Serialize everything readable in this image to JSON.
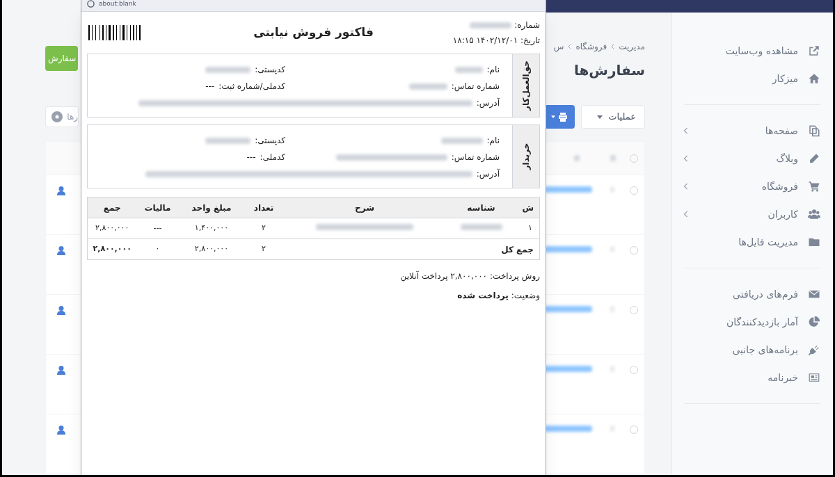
{
  "popup": {
    "address": "about:blank"
  },
  "invoice": {
    "number_label": "شماره:",
    "date_label": "تاریخ:",
    "date": "۱۴۰۲/۱۲/۰۱ ۱۸:۱۵",
    "title": "فاکتور فروش نیابتی",
    "parties": [
      {
        "heading": "حق‌العمل‌کار",
        "name_label": "نام:",
        "postal_label": "کدپستی:",
        "phone_label": "شماره تماس:",
        "id_label": "کدملی/شماره ثبت:",
        "id_value": "---",
        "address_label": "آدرس:"
      },
      {
        "heading": "خریدار",
        "name_label": "نام:",
        "postal_label": "کدپستی:",
        "phone_label": "شماره تماس:",
        "id_label": "کدملی:",
        "id_value": "---",
        "address_label": "آدرس:"
      }
    ],
    "table": {
      "columns": [
        "ش",
        "شناسه",
        "شرح",
        "تعداد",
        "مبلغ واحد",
        "مالیات",
        "جمع"
      ],
      "rows": [
        {
          "cells": [
            "۱",
            null,
            null,
            "۲",
            "۱,۴۰۰,۰۰۰",
            "---",
            "۲,۸۰۰,۰۰۰"
          ]
        }
      ],
      "total": {
        "label": "جمع کل",
        "cells": [
          "۲",
          "۲,۸۰۰,۰۰۰",
          "۰",
          "۲,۸۰۰,۰۰۰"
        ]
      }
    },
    "payment": [
      {
        "label": "روش پرداخت:",
        "value": "۲,۸۰۰,۰۰۰ پرداخت آنلاین",
        "bold": false
      },
      {
        "label": "وضعیت:",
        "value": "پرداخت شده",
        "bold": true
      }
    ]
  },
  "orders_table": {
    "all_checked": false,
    "rows": [
      {
        "checked": false
      },
      {
        "checked": false
      },
      {
        "checked": false
      },
      {
        "checked": false
      },
      {
        "checked": false
      }
    ]
  },
  "page": {
    "breadcrumb": [
      "مدیریت",
      "فروشگاه",
      "س"
    ],
    "title": "سفارش‌ها",
    "add_button": "سفارش",
    "actions_button": "عملیات",
    "search_placeholder": "رها"
  },
  "sidebar": {
    "groups": [
      [
        {
          "label": "مشاهده وب‌سایت",
          "expandable": false
        },
        {
          "label": "میزکار",
          "expandable": false
        }
      ],
      [
        {
          "label": "صفحه‌ها",
          "expandable": true
        },
        {
          "label": "وبلاگ",
          "expandable": true
        },
        {
          "label": "فروشگاه",
          "expandable": true
        },
        {
          "label": "کاربران",
          "expandable": true
        },
        {
          "label": "مدیریت فایل‌ها",
          "expandable": false
        }
      ],
      [
        {
          "label": "فرم‌های دریافتی",
          "expandable": false
        },
        {
          "label": "آمار بازدیدکنندگان",
          "expandable": false
        },
        {
          "label": "برنامه‌های جانبی",
          "expandable": false
        },
        {
          "label": "خبرنامه",
          "expandable": false
        }
      ]
    ]
  }
}
